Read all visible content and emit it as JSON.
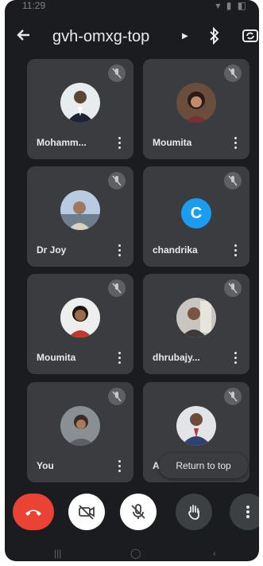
{
  "meeting": {
    "code": "gvh-omxg-top"
  },
  "status_bar": {
    "time": "11:29"
  },
  "participants": [
    {
      "name": "Mohamm..."
    },
    {
      "name": "Moumita"
    },
    {
      "name": "Dr Joy"
    },
    {
      "name": "chandrika",
      "initial": "C",
      "avatar_color": "#1a9df0"
    },
    {
      "name": "Moumita"
    },
    {
      "name": "dhrubajy..."
    },
    {
      "name": "You"
    },
    {
      "name": "A"
    }
  ],
  "return_to_top": "Return to top",
  "colors": {
    "background": "#1b1c1f",
    "tile": "#3b3c40",
    "end_call": "#ea4335",
    "initial_avatar": "#1a9df0"
  },
  "icons": {
    "back": "arrow-left-icon",
    "dropdown": "chevron-right-icon",
    "bluetooth": "bluetooth-icon",
    "camera_flip": "camera-flip-icon",
    "tile_mute": "mic-off-icon",
    "tile_more": "more-vert-icon",
    "end_call": "call-end-icon",
    "camera": "camera-off-icon",
    "mic": "mic-off-icon",
    "hand": "raise-hand-icon",
    "more": "more-vert-icon"
  }
}
